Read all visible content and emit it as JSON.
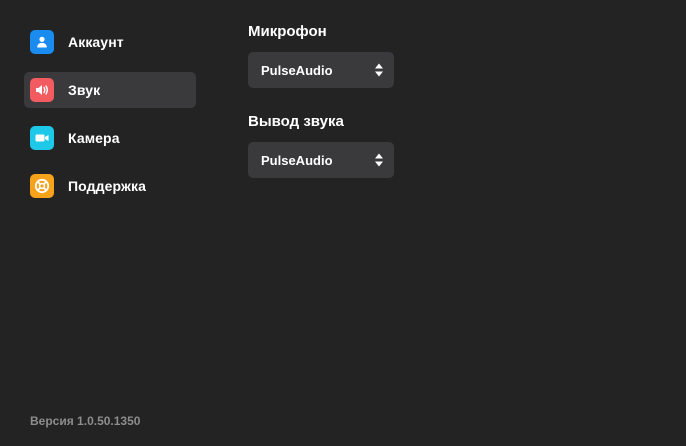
{
  "sidebar": {
    "items": [
      {
        "label": "Аккаунт",
        "icon": "user-icon",
        "color": "#1a8cf0"
      },
      {
        "label": "Звук",
        "icon": "speaker-icon",
        "color": "#f25c61"
      },
      {
        "label": "Камера",
        "icon": "camera-icon",
        "color": "#1ec8e8"
      },
      {
        "label": "Поддержка",
        "icon": "lifebuoy-icon",
        "color": "#f7a21b"
      }
    ],
    "active": "Звук",
    "version": "Версия 1.0.50.1350"
  },
  "main": {
    "microphone": {
      "title": "Микрофон",
      "value": "PulseAudio"
    },
    "output": {
      "title": "Вывод звука",
      "value": "PulseAudio"
    }
  },
  "colors": {
    "background": "#232323",
    "active_item": "#3a3a3c",
    "select_bg": "#3a3a3c",
    "version_text": "#8d8d8d"
  }
}
